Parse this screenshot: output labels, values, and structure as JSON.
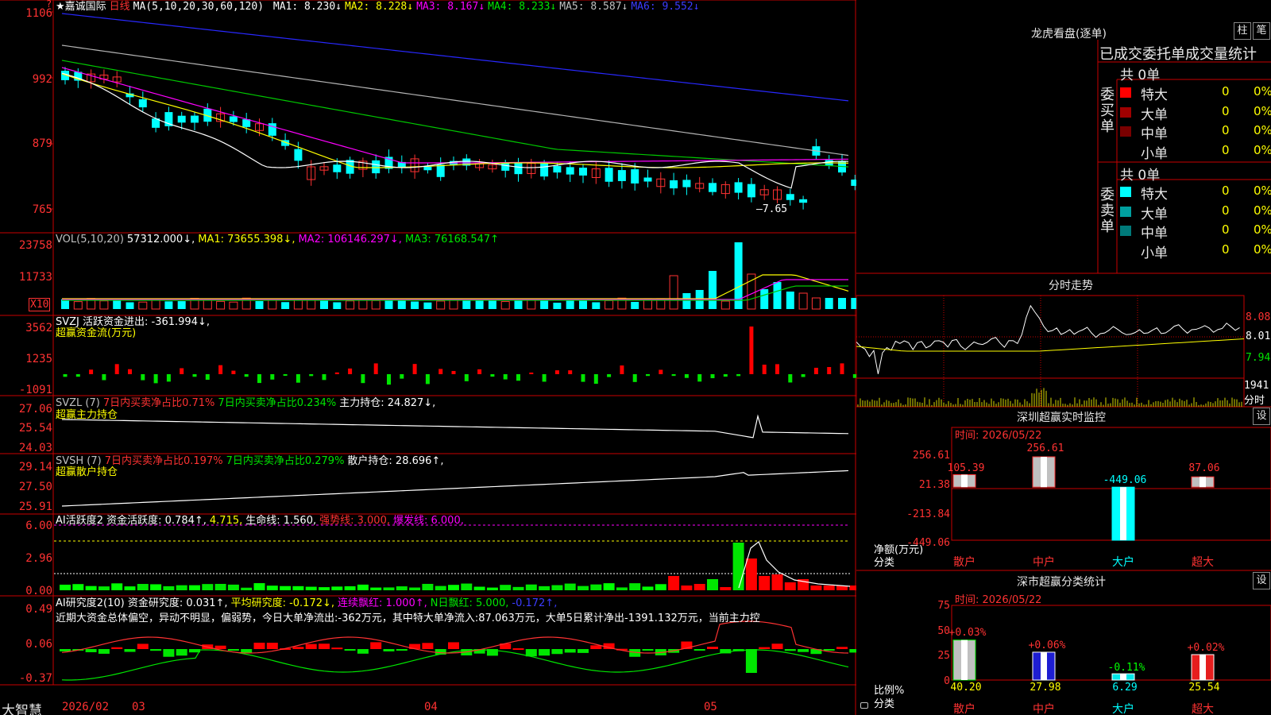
{
  "main": {
    "stock_name": "★嘉诚国际",
    "period": "日线",
    "ma_params": "MA(5,10,20,30,60,120)",
    "ma_items": [
      {
        "label": "MA1: 8.230↓",
        "color": "#ffffff"
      },
      {
        "label": "MA2: 8.228↓",
        "color": "#ffff00"
      },
      {
        "label": "MA3: 8.167↓",
        "color": "#ff00ff"
      },
      {
        "label": "MA4: 8.233↓",
        "color": "#00e600"
      },
      {
        "label": "MA5: 8.587↓",
        "color": "#c0c0c0"
      },
      {
        "label": "MA6: 9.552↓",
        "color": "#3c3cff"
      }
    ],
    "y_ticks": [
      "1106",
      "992",
      "879",
      "765"
    ],
    "low_label": "7.65",
    "corner_mark": "?"
  },
  "vol": {
    "header": [
      {
        "label": "VOL(5,10,20)",
        "color": "#c0c0c0"
      },
      {
        "label": "57312.000↓,",
        "color": "#ffffff"
      },
      {
        "label": "MA1: 73655.398↓,",
        "color": "#ffff00"
      },
      {
        "label": "MA2: 106146.297↓,",
        "color": "#ff00ff"
      },
      {
        "label": "MA3: 76168.547↑",
        "color": "#00e600"
      }
    ],
    "y_ticks": [
      "23758",
      "11733"
    ],
    "unit": "X10"
  },
  "svzj": {
    "header": [
      {
        "label": "SVZJ  活跃资金进出: -361.994↓,",
        "color": "#ffffff"
      }
    ],
    "subtitle": "超赢资金流(万元)",
    "y_ticks": [
      "3562",
      "1235",
      "-1091"
    ]
  },
  "svzl": {
    "header": [
      {
        "label": "SVZL (7)",
        "color": "#c0c0c0"
      },
      {
        "label": "7日内买卖净占比0.71%",
        "color": "#ff3232"
      },
      {
        "label": "7日内买卖净占比0.234%",
        "color": "#00e600"
      },
      {
        "label": "主力持仓: 24.827↓,",
        "color": "#ffffff"
      }
    ],
    "subtitle": "超赢主力持仓",
    "y_ticks": [
      "27.06",
      "25.54",
      "24.03"
    ]
  },
  "svsh": {
    "header": [
      {
        "label": "SVSH (7)",
        "color": "#c0c0c0"
      },
      {
        "label": "7日内买卖净占比0.197%",
        "color": "#ff3232"
      },
      {
        "label": "7日内买卖净占比0.279%",
        "color": "#00e600"
      },
      {
        "label": "散户持仓: 28.696↑,",
        "color": "#ffffff"
      }
    ],
    "subtitle": "超赢散户持仓",
    "y_ticks": [
      "29.14",
      "27.50",
      "25.91"
    ]
  },
  "ai_hyd": {
    "header": [
      {
        "label": "AI活跃度2 资金活跃度: 0.784↑,",
        "color": "#ffffff"
      },
      {
        "label": "4.715,",
        "color": "#ffff00"
      },
      {
        "label": "生命线: 1.560,",
        "color": "#ffffff"
      },
      {
        "label": "强势线: 3.000,",
        "color": "#ff3232"
      },
      {
        "label": "爆发线: 6.000,",
        "color": "#ff00ff"
      }
    ],
    "y_ticks": [
      "6.00",
      "2.96",
      "0.00"
    ]
  },
  "ai_yjd": {
    "header": [
      {
        "label": "AI研究度2(10) 资金研究度: 0.031↑,",
        "color": "#ffffff"
      },
      {
        "label": "平均研究度: -0.172↓,",
        "color": "#ffff00"
      },
      {
        "label": "连续飘红: 1.000↑,",
        "color": "#ff00ff"
      },
      {
        "label": "N日飘红: 5.000,",
        "color": "#00e600"
      },
      {
        "label": "-0.172↑,",
        "color": "#3c3cff"
      }
    ],
    "note": "近期大资金总体偏空，异动不明显，偏弱势，今日大单净流出:-362万元，其中特大单净流入:87.063万元，大单5日累计净出-1391.132万元，当前主力控",
    "y_ticks": [
      "0.49",
      "0.06",
      "-0.37"
    ]
  },
  "bottom": {
    "brand": "大智慧",
    "dates": [
      "2026/02",
      "03",
      "04",
      "05"
    ]
  },
  "lhb": {
    "title": "龙虎看盘(逐单)",
    "btn_col": "柱",
    "btn_tick": "笔",
    "tabs": "已成交委托单成交量统计",
    "buy_label": "委买单",
    "sell_label": "委卖单",
    "buy_total": "共 0单",
    "sell_total": "共 0单",
    "buy_rows": [
      {
        "label": "特大",
        "value": "0",
        "pct": "0%",
        "color": "#ff0000"
      },
      {
        "label": "大单",
        "value": "0",
        "pct": "0%",
        "color": "#a00000"
      },
      {
        "label": "中单",
        "value": "0",
        "pct": "0%",
        "color": "#7a0000"
      },
      {
        "label": "小单",
        "value": "0",
        "pct": "0%",
        "color": "#000000"
      }
    ],
    "sell_rows": [
      {
        "label": "特大",
        "value": "0",
        "pct": "0%",
        "color": "#00ffff"
      },
      {
        "label": "大单",
        "value": "0",
        "pct": "0%",
        "color": "#00a0a0"
      },
      {
        "label": "中单",
        "value": "0",
        "pct": "0%",
        "color": "#007a7a"
      },
      {
        "label": "小单",
        "value": "0",
        "pct": "0%",
        "color": "#000000"
      }
    ]
  },
  "fenshi": {
    "title": "分时走势",
    "y_ticks": [
      "8.08",
      "8.01",
      "7.94"
    ],
    "vol_tick": "1941",
    "tag": "分时"
  },
  "sz_monitor": {
    "title": "深圳超赢实时监控",
    "btn": "设",
    "time": "时间: 2026/05/22",
    "y_ticks": [
      "256.61",
      "21.38",
      "-213.84",
      "-449.06"
    ],
    "y_label_1": "净额(万元)",
    "y_label_2": "分类",
    "categories": [
      "散户",
      "中户",
      "大户",
      "超大"
    ],
    "values": [
      "105.39",
      "256.61",
      "-449.06",
      "87.06"
    ],
    "chart_data": {
      "type": "bar",
      "categories": [
        "散户",
        "中户",
        "大户",
        "超大"
      ],
      "values": [
        105.39,
        256.61,
        -449.06,
        87.06
      ],
      "ylim": [
        -449.06,
        256.61
      ]
    }
  },
  "sz_class": {
    "title": "深市超赢分类统计",
    "btn": "设",
    "time": "时间: 2026/05/22",
    "y_ticks": [
      "75",
      "50",
      "25",
      "0"
    ],
    "y_label_1": "比例%",
    "y_label_2": "分类",
    "categories": [
      "散户",
      "中户",
      "大户",
      "超大"
    ],
    "top_labels": [
      "+0.03%",
      "+0.06%",
      "-0.11%",
      "+0.02%"
    ],
    "values": [
      "40.20",
      "27.98",
      "6.29",
      "25.54"
    ],
    "chart_data": {
      "type": "bar",
      "categories": [
        "散户",
        "中户",
        "大户",
        "超大"
      ],
      "values": [
        40.2,
        27.98,
        6.29,
        25.54
      ],
      "changes": [
        "+0.03%",
        "+0.06%",
        "-0.11%",
        "+0.02%"
      ],
      "ylim": [
        0,
        75
      ]
    }
  }
}
